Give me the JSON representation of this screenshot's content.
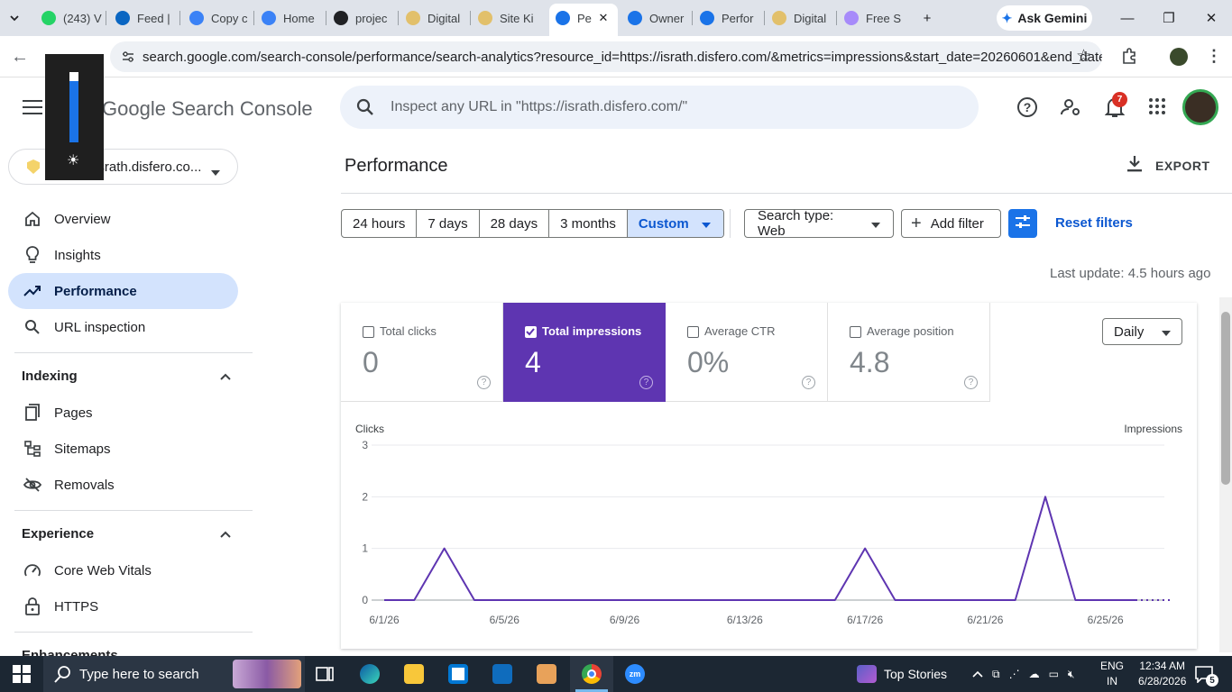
{
  "browser": {
    "tabs": [
      {
        "label": "(243) V",
        "icon": "whatsapp-icon",
        "color": "#25d366"
      },
      {
        "label": "Feed |",
        "icon": "linkedin-icon",
        "color": "#0a66c2"
      },
      {
        "label": "Copy c",
        "icon": "copy-ai-icon",
        "color": "#3b82f6"
      },
      {
        "label": "Home",
        "icon": "home-site-icon",
        "color": "#3b82f6"
      },
      {
        "label": "projec",
        "icon": "openai-icon",
        "color": "#202124"
      },
      {
        "label": "Digital",
        "icon": "shield-icon",
        "color": "#e2c06b"
      },
      {
        "label": "Site Ki",
        "icon": "shield-icon",
        "color": "#e2c06b"
      },
      {
        "label": "Pe",
        "icon": "search-console-icon",
        "color": "#1a73e8"
      },
      {
        "label": "Owner",
        "icon": "search-console-icon",
        "color": "#1a73e8"
      },
      {
        "label": "Perfor",
        "icon": "search-console-icon",
        "color": "#1a73e8"
      },
      {
        "label": "Digital",
        "icon": "shield-icon",
        "color": "#e2c06b"
      },
      {
        "label": "Free S",
        "icon": "spark-icon",
        "color": "#a78bfa"
      }
    ],
    "gemini_label": "Ask Gemini",
    "url": "search.google.com/search-console/performance/search-analytics?resource_id=https://israth.disfero.com/&metrics=impressions&start_date=20260601&end_date=..."
  },
  "header": {
    "logo": "Google Search Console",
    "search_placeholder": "Inspect any URL in \"https://israth.disfero.com/\"",
    "notification_count": "7"
  },
  "sidebar": {
    "property": "https://israth.disfero.co...",
    "items": [
      {
        "label": "Overview",
        "icon": "home-icon"
      },
      {
        "label": "Insights",
        "icon": "lightbulb-icon"
      },
      {
        "label": "Performance",
        "icon": "trending-up-icon"
      },
      {
        "label": "URL inspection",
        "icon": "search-icon"
      }
    ],
    "indexing": {
      "title": "Indexing",
      "items": [
        {
          "label": "Pages",
          "icon": "pages-icon"
        },
        {
          "label": "Sitemaps",
          "icon": "sitemap-icon"
        },
        {
          "label": "Removals",
          "icon": "visibility-off-icon"
        }
      ]
    },
    "experience": {
      "title": "Experience",
      "items": [
        {
          "label": "Core Web Vitals",
          "icon": "speed-icon"
        },
        {
          "label": "HTTPS",
          "icon": "lock-icon"
        }
      ]
    },
    "enhancements_title": "Enhancements"
  },
  "main": {
    "title": "Performance",
    "export_label": "EXPORT",
    "date_ranges": [
      "24 hours",
      "7 days",
      "28 days",
      "3 months",
      "Custom"
    ],
    "search_type": "Search type: Web",
    "add_filter": "Add filter",
    "reset_filters": "Reset filters",
    "last_update": "Last update: 4.5 hours ago",
    "metrics": [
      {
        "label": "Total clicks",
        "value": "0",
        "checked": false
      },
      {
        "label": "Total impressions",
        "value": "4",
        "checked": true
      },
      {
        "label": "Average CTR",
        "value": "0%",
        "checked": false
      },
      {
        "label": "Average position",
        "value": "4.8",
        "checked": false
      }
    ],
    "granularity": "Daily"
  },
  "chart_data": {
    "type": "line",
    "left_axis_label": "Clicks",
    "right_axis_label": "Impressions",
    "ylim": [
      0,
      3
    ],
    "y_ticks": [
      "0",
      "1",
      "2",
      "3"
    ],
    "x_tick_labels": [
      "6/1/26",
      "6/5/26",
      "6/9/26",
      "6/13/26",
      "6/17/26",
      "6/21/26",
      "6/25/26"
    ],
    "x": [
      "6/1/26",
      "6/2/26",
      "6/3/26",
      "6/4/26",
      "6/5/26",
      "6/6/26",
      "6/7/26",
      "6/8/26",
      "6/9/26",
      "6/10/26",
      "6/11/26",
      "6/12/26",
      "6/13/26",
      "6/14/26",
      "6/15/26",
      "6/16/26",
      "6/17/26",
      "6/18/26",
      "6/19/26",
      "6/20/26",
      "6/21/26",
      "6/22/26",
      "6/23/26",
      "6/24/26",
      "6/25/26",
      "6/26/26"
    ],
    "series": [
      {
        "name": "Impressions",
        "color": "#5e35b1",
        "values": [
          0,
          0,
          1,
          0,
          0,
          0,
          0,
          0,
          0,
          0,
          0,
          0,
          0,
          0,
          0,
          0,
          1,
          0,
          0,
          0,
          0,
          0,
          2,
          0,
          0,
          0
        ]
      }
    ],
    "grid": true
  },
  "taskbar": {
    "search_placeholder": "Type here to search",
    "news": "Top Stories",
    "lang": "ENG",
    "region": "IN",
    "time": "12:34 AM",
    "date": "6/28/2026",
    "notif_count": "5"
  },
  "colors": {
    "accent": "#1a73e8",
    "impressions": "#5e35b1",
    "active_nav": "#d3e3fd"
  }
}
